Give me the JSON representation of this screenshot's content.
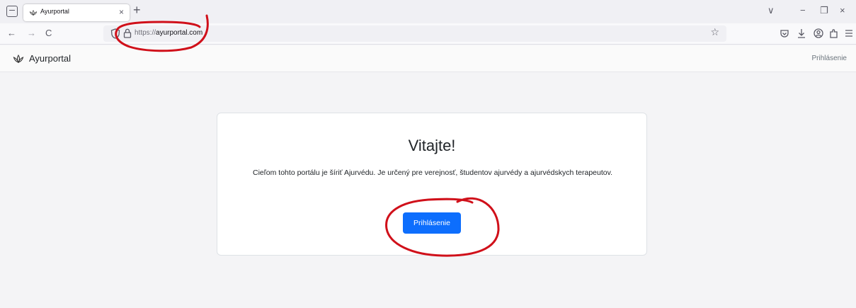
{
  "browser": {
    "tab_title": "Ayurportal",
    "tab_close": "×",
    "new_tab": "+",
    "nav_back": "←",
    "nav_forward": "→",
    "nav_reload": "C",
    "url_protocol": "https://",
    "url_host": "ayurportal.com",
    "bookmark_star": "☆",
    "window_menu": "∨",
    "window_minimize": "−",
    "window_restore": "❐",
    "window_close": "×"
  },
  "site": {
    "brand": "Ayurportal",
    "header_login": "Prihlásenie"
  },
  "card": {
    "title": "Vitajte!",
    "text": "Cieľom tohto portálu je šíriť Ajurvédu. Je určený pre verejnosť, študentov ajurvédy a ajurvédskych terapeutov.",
    "button": "Prihlásenie"
  },
  "colors": {
    "primary": "#0d6efd",
    "annotation": "#d0101a"
  },
  "icons": [
    "tab-list-icon",
    "lotus-icon",
    "shield-icon",
    "lock-icon",
    "star-icon",
    "pocket-icon",
    "download-icon",
    "account-icon",
    "extensions-icon",
    "menu-icon"
  ]
}
